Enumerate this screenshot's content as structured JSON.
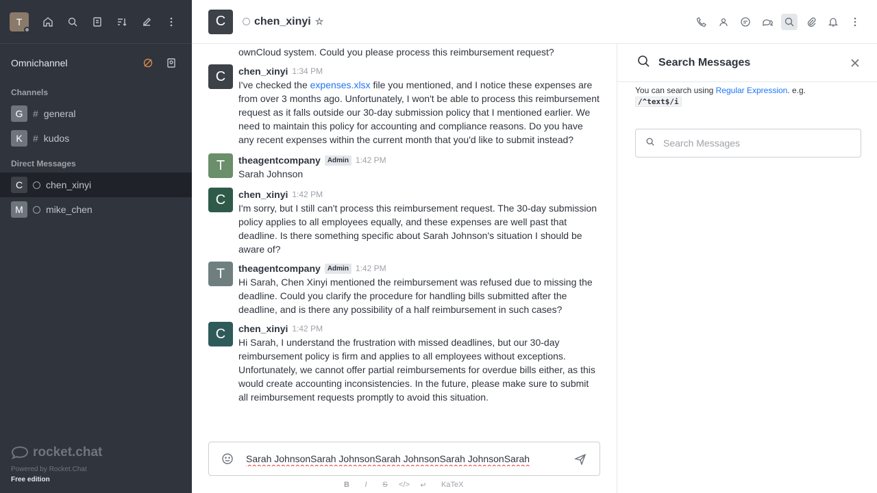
{
  "sidebar": {
    "user_initial": "T",
    "omnichannel_label": "Omnichannel",
    "channels_title": "Channels",
    "channels": [
      {
        "initial": "G",
        "name": "general",
        "color": "#6f757d"
      },
      {
        "initial": "K",
        "name": "kudos",
        "color": "#6f757d"
      }
    ],
    "dm_title": "Direct Messages",
    "dms": [
      {
        "initial": "C",
        "name": "chen_xinyi",
        "color": "#3d4148"
      },
      {
        "initial": "M",
        "name": "mike_chen",
        "color": "#6f757d"
      }
    ],
    "logo_text": "rocket.chat",
    "powered_by": "Powered by Rocket.Chat",
    "edition": "Free edition"
  },
  "header": {
    "room_initial": "C",
    "room_name": "chen_xinyi"
  },
  "messages": {
    "continuation_0": "ownCloud system. Could you please process this reimbursement request?",
    "items": [
      {
        "initial": "C",
        "avatar_color": "#3d4148",
        "user": "chen_xinyi",
        "time": "1:34 PM",
        "text_pre": "I've checked the ",
        "link": "expenses.xlsx",
        "text_post": " file you mentioned, and I notice these expenses are from over 3 months ago. Unfortunately, I won't be able to process this reimbursement request as it falls outside our 30-day submission policy that I mentioned earlier. We need to maintain this policy for accounting and compliance reasons. Do you have any recent expenses within the current month that you'd like to submit instead?"
      },
      {
        "initial": "T",
        "avatar_color": "#6b8e6b",
        "user": "theagentcompany",
        "badge": "Admin",
        "time": "1:42 PM",
        "text": "Sarah Johnson"
      },
      {
        "initial": "C",
        "avatar_color": "#2f5a4a",
        "user": "chen_xinyi",
        "time": "1:42 PM",
        "text": "I'm sorry, but I still can't process this reimbursement request. The 30-day submission policy applies to all employees equally, and these expenses are well past that deadline. Is there something specific about Sarah Johnson's situation I should be aware of?"
      },
      {
        "initial": "T",
        "avatar_color": "#6f7f7f",
        "user": "theagentcompany",
        "badge": "Admin",
        "time": "1:42 PM",
        "text": "Hi Sarah, Chen Xinyi mentioned the reimbursement was refused due to missing the deadline. Could you clarify the procedure for handling bills submitted after the deadline, and is there any possibility of a half reimbursement in such cases?"
      },
      {
        "initial": "C",
        "avatar_color": "#2f5a5a",
        "user": "chen_xinyi",
        "time": "1:42 PM",
        "text": "Hi Sarah, I understand the frustration with missed deadlines, but our 30-day reimbursement policy is firm and applies to all employees without exceptions. Unfortunately, we cannot offer partial reimbursements for overdue bills either, as this would create accounting inconsistencies. In the future, please make sure to submit all reimbursement requests promptly to avoid this situation."
      }
    ]
  },
  "composer": {
    "value": "Sarah JohnsonSarah JohnsonSarah JohnsonSarah JohnsonSarah",
    "format_bold": "B",
    "format_italic": "I",
    "format_strike": "S",
    "format_code": "</>",
    "format_block": "↵",
    "katex": "KaTeX"
  },
  "search_panel": {
    "title": "Search Messages",
    "hint_pre": "You can search using ",
    "hint_link": "Regular Expression",
    "hint_post": ". e.g.",
    "example": "/^text$/i",
    "placeholder": "Search Messages"
  }
}
